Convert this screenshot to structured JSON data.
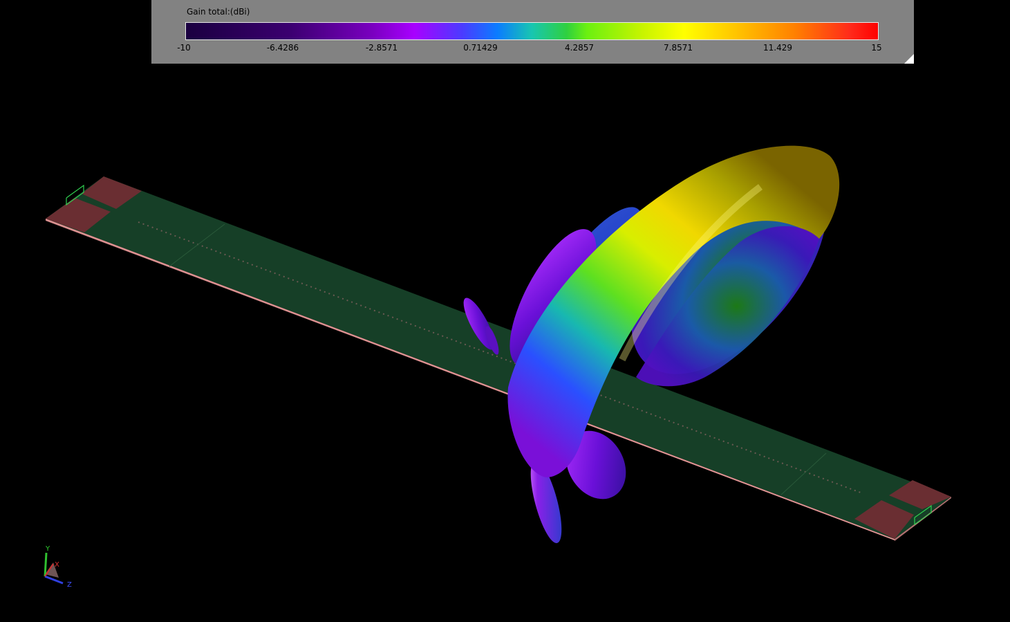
{
  "legend": {
    "title": "Gain total:(dBi)",
    "ticks": [
      "-10",
      "-6.4286",
      "-2.8571",
      "0.71429",
      "4.2857",
      "7.8571",
      "11.429",
      "15"
    ]
  },
  "colors": {
    "board": "#163f27",
    "port_pad": "#6a2e32",
    "background": "#000000",
    "panel": "#828282"
  },
  "axes": {
    "x": "X",
    "y": "Y",
    "z": "Z"
  }
}
